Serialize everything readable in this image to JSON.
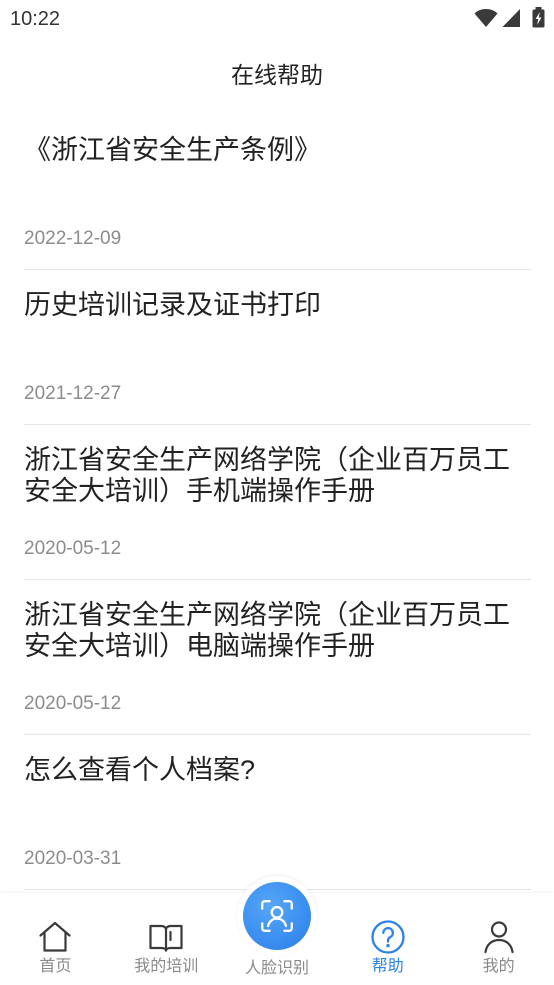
{
  "status_bar": {
    "time": "10:22",
    "icons": [
      "wifi-icon",
      "signal-icon",
      "battery-charging-icon"
    ]
  },
  "header": {
    "title": "在线帮助"
  },
  "articles": [
    {
      "title": "《浙江省安全生产条例》",
      "date": "2022-12-09"
    },
    {
      "title": "历史培训记录及证书打印",
      "date": "2021-12-27"
    },
    {
      "title": "浙江省安全生产网络学院（企业百万员工安全大培训）手机端操作手册",
      "date": "2020-05-12"
    },
    {
      "title": "浙江省安全生产网络学院（企业百万员工安全大培训）电脑端操作手册",
      "date": "2020-05-12"
    },
    {
      "title": "怎么查看个人档案?",
      "date": "2020-03-31"
    }
  ],
  "bottom_nav": {
    "items": [
      {
        "label": "首页",
        "icon": "home-icon",
        "active": false
      },
      {
        "label": "我的培训",
        "icon": "book-icon",
        "active": false
      },
      {
        "label": "人脸识别",
        "icon": "face-scan-icon",
        "active": false
      },
      {
        "label": "帮助",
        "icon": "help-icon",
        "active": true
      },
      {
        "label": "我的",
        "icon": "person-icon",
        "active": false
      }
    ]
  },
  "colors": {
    "accent": "#2b82e8",
    "title_text": "#222222",
    "date_text": "#8c8c8c",
    "divider": "#e6e6e6",
    "nav_inactive": "#8a8a8a",
    "nav_icon": "#3a3a3a",
    "face_button": "#3a8ef0"
  }
}
